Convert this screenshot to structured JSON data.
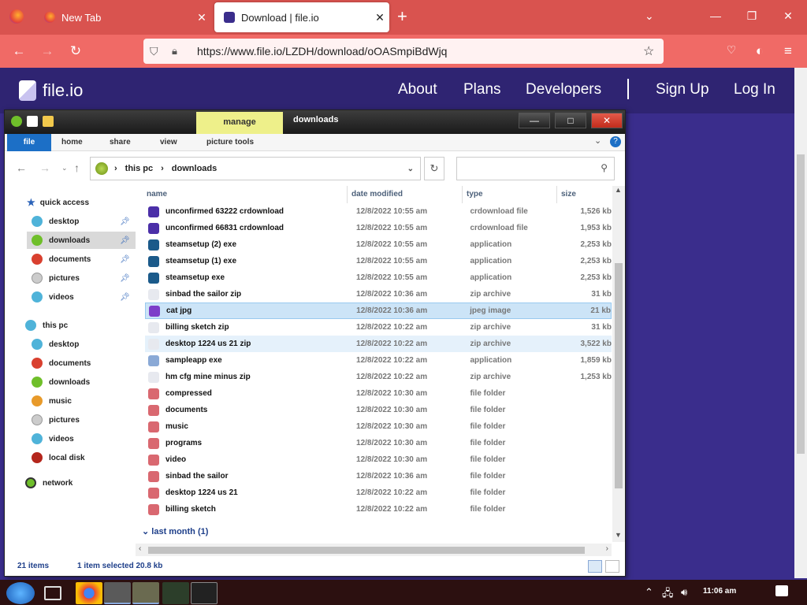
{
  "browser": {
    "tabs": [
      {
        "label": "New Tab"
      },
      {
        "label": "Download | file.io"
      }
    ],
    "url": "https://www.file.io/LZDH/download/oOASmpiBdWjq"
  },
  "site": {
    "logo_text": "file.io",
    "nav": [
      "About",
      "Plans",
      "Developers",
      "Sign Up",
      "Log In"
    ]
  },
  "explorer": {
    "context_tab": "manage",
    "title": "downloads",
    "ribbon_tabs": [
      "file",
      "home",
      "share",
      "view",
      "picture tools"
    ],
    "breadcrumb": [
      "this pc",
      "downloads"
    ],
    "quick_access_label": "quick access",
    "nav_quick": [
      {
        "label": "desktop",
        "color": "#4fb3d9"
      },
      {
        "label": "downloads",
        "color": "#6fbf2a"
      },
      {
        "label": "documents",
        "color": "#d9402f"
      },
      {
        "label": "pictures",
        "color": "#cccccc"
      },
      {
        "label": "videos",
        "color": "#4fb3d9"
      }
    ],
    "nav_thispc_label": "this pc",
    "nav_thispc": [
      {
        "label": "desktop",
        "color": "#4fb3d9"
      },
      {
        "label": "documents",
        "color": "#d9402f"
      },
      {
        "label": "downloads",
        "color": "#6fbf2a"
      },
      {
        "label": "music",
        "color": "#e89a2a"
      },
      {
        "label": "pictures",
        "color": "#cccccc"
      },
      {
        "label": "videos",
        "color": "#4fb3d9"
      },
      {
        "label": "local disk",
        "color": "#b4261c"
      }
    ],
    "nav_network_label": "network",
    "columns": [
      "name",
      "date modified",
      "type",
      "size"
    ],
    "files": [
      {
        "name": "unconfirmed 63222 crdownload",
        "date": "12/8/2022 10:55 am",
        "type": "crdownload file",
        "size": "1,526 kb",
        "icon": "#4b2fa8"
      },
      {
        "name": "unconfirmed 66831 crdownload",
        "date": "12/8/2022 10:55 am",
        "type": "crdownload file",
        "size": "1,953 kb",
        "icon": "#4b2fa8"
      },
      {
        "name": "steamsetup (2) exe",
        "date": "12/8/2022 10:55 am",
        "type": "application",
        "size": "2,253 kb",
        "icon": "#1b5a8a"
      },
      {
        "name": "steamsetup (1) exe",
        "date": "12/8/2022 10:55 am",
        "type": "application",
        "size": "2,253 kb",
        "icon": "#1b5a8a"
      },
      {
        "name": "steamsetup exe",
        "date": "12/8/2022 10:55 am",
        "type": "application",
        "size": "2,253 kb",
        "icon": "#1b5a8a"
      },
      {
        "name": "sinbad the sailor zip",
        "date": "12/8/2022 10:36 am",
        "type": "zip archive",
        "size": "31 kb",
        "icon": "#e7e9ef"
      },
      {
        "name": "cat jpg",
        "date": "12/8/2022 10:36 am",
        "type": "jpeg image",
        "size": "21 kb",
        "icon": "#7d3ec9"
      },
      {
        "name": "billing sketch zip",
        "date": "12/8/2022 10:22 am",
        "type": "zip archive",
        "size": "31 kb",
        "icon": "#e7e9ef"
      },
      {
        "name": "desktop 1224 us 21 zip",
        "date": "12/8/2022 10:22 am",
        "type": "zip archive",
        "size": "3,522 kb",
        "icon": "#e7e9ef"
      },
      {
        "name": "sampleapp exe",
        "date": "12/8/2022 10:22 am",
        "type": "application",
        "size": "1,859 kb",
        "icon": "#8aa9d6"
      },
      {
        "name": "hm cfg mine minus zip",
        "date": "12/8/2022 10:22 am",
        "type": "zip archive",
        "size": "1,253 kb",
        "icon": "#e7e9ef"
      },
      {
        "name": "compressed",
        "date": "12/8/2022 10:30 am",
        "type": "file folder",
        "size": "",
        "icon": "#d96870"
      },
      {
        "name": "documents",
        "date": "12/8/2022 10:30 am",
        "type": "file folder",
        "size": "",
        "icon": "#d96870"
      },
      {
        "name": "music",
        "date": "12/8/2022 10:30 am",
        "type": "file folder",
        "size": "",
        "icon": "#d96870"
      },
      {
        "name": "programs",
        "date": "12/8/2022 10:30 am",
        "type": "file folder",
        "size": "",
        "icon": "#d96870"
      },
      {
        "name": "video",
        "date": "12/8/2022 10:30 am",
        "type": "file folder",
        "size": "",
        "icon": "#d96870"
      },
      {
        "name": "sinbad the sailor",
        "date": "12/8/2022 10:36 am",
        "type": "file folder",
        "size": "",
        "icon": "#d96870"
      },
      {
        "name": "desktop 1224 us 21",
        "date": "12/8/2022 10:22 am",
        "type": "file folder",
        "size": "",
        "icon": "#d96870"
      },
      {
        "name": "billing sketch",
        "date": "12/8/2022 10:22 am",
        "type": "file folder",
        "size": "",
        "icon": "#d96870"
      }
    ],
    "group_header": "last month (1)",
    "status_items": "21 items",
    "status_selected": "1 item selected 20.8 kb"
  },
  "taskbar": {
    "clock": "11:06 am"
  }
}
